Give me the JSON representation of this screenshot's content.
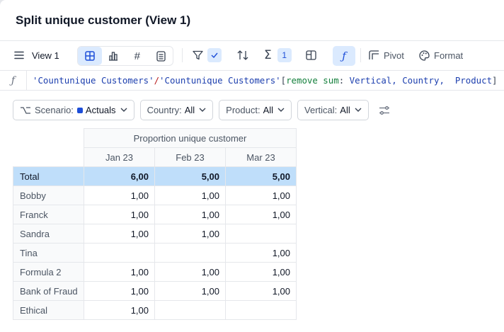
{
  "window": {
    "title": "Split unique customer (View 1)"
  },
  "toolbar": {
    "view_label": "View 1",
    "filter_badge": "1",
    "pivot_label": "Pivot",
    "format_label": "Format"
  },
  "formula": {
    "part1": "'Countunique Customers'",
    "op": "/",
    "part2": "'Countunique Customers'",
    "open": "[",
    "fn": "remove sum",
    "colon": ": ",
    "args": "Vertical, Country,  Product",
    "close": "]"
  },
  "filters": {
    "scenario_label": "Scenario:",
    "scenario_value": "Actuals",
    "country_label": "Country:",
    "country_value": "All",
    "product_label": "Product:",
    "product_value": "All",
    "vertical_label": "Vertical:",
    "vertical_value": "All"
  },
  "colors": {
    "accent": "#1d4ed8",
    "selected_row": "#bfdefa",
    "active_tab": "#dbeafe"
  },
  "table": {
    "group_header": "Proportion unique customer",
    "columns": [
      "Jan 23",
      "Feb 23",
      "Mar 23"
    ],
    "total": {
      "label": "Total",
      "values": [
        "6,00",
        "5,00",
        "5,00"
      ]
    },
    "rows": [
      {
        "label": "Bobby",
        "values": [
          "1,00",
          "1,00",
          "1,00"
        ]
      },
      {
        "label": "Franck",
        "values": [
          "1,00",
          "1,00",
          "1,00"
        ]
      },
      {
        "label": "Sandra",
        "values": [
          "1,00",
          "1,00",
          ""
        ]
      },
      {
        "label": "Tina",
        "values": [
          "",
          "",
          "1,00"
        ]
      },
      {
        "label": "Formula 2",
        "values": [
          "1,00",
          "1,00",
          "1,00"
        ]
      },
      {
        "label": "Bank of Fraud",
        "values": [
          "1,00",
          "1,00",
          "1,00"
        ]
      },
      {
        "label": "Ethical",
        "values": [
          "1,00",
          "",
          ""
        ]
      }
    ]
  }
}
